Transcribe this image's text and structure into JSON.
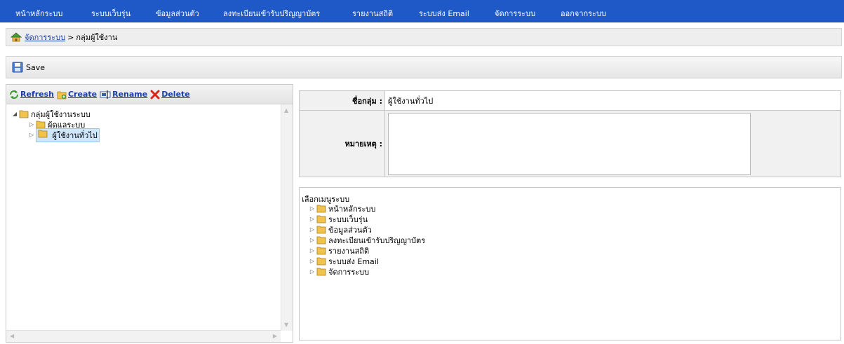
{
  "nav": {
    "items": [
      "หน้าหลักระบบ",
      "ระบบเว็บรุ่น",
      "ข้อมูลส่วนตัว",
      "ลงทะเบียนเข้ารับปริญญาบัตร",
      "รายงานสถิติ",
      "ระบบส่ง Email",
      "จัดการระบบ",
      "ออกจากระบบ"
    ]
  },
  "breadcrumb": {
    "link": "จัดการระบบ",
    "separator": ">",
    "current": "กลุ่มผู้ใช้งาน"
  },
  "toolbar": {
    "save_label": "Save"
  },
  "actions": {
    "refresh": "Refresh",
    "create": "Create",
    "rename": "Rename",
    "delete": "Delete"
  },
  "tree": {
    "root": "กลุ่มผู้ใช้งานระบบ",
    "children": [
      "ผู้ดูแลระบบ",
      "ผู้ใช้งานทั่วไป"
    ],
    "selected_index": 1
  },
  "form": {
    "group_name_label": "ชื่อกลุ่ม :",
    "group_name_value": "ผู้ใช้งานทั่วไป",
    "remark_label": "หมายเหตุ :",
    "remark_value": ""
  },
  "menu_select": {
    "title": "เลือกเมนูระบบ",
    "items": [
      "หน้าหลักระบบ",
      "ระบบเว็บรุ่น",
      "ข้อมูลส่วนตัว",
      "ลงทะเบียนเข้ารับปริญญาบัตร",
      "รายงานสถิติ",
      "ระบบส่ง Email",
      "จัดการระบบ"
    ]
  },
  "colors": {
    "nav_bg": "#1f59c7",
    "link": "#1a3fa5",
    "selected_bg": "#cfe6fb"
  }
}
